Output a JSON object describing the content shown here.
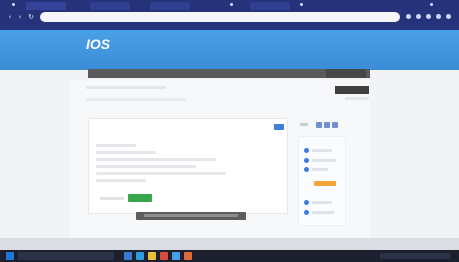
{
  "browser": {
    "tabs": [
      {
        "label": ""
      },
      {
        "label": ""
      },
      {
        "label": ""
      },
      {
        "label": ""
      }
    ],
    "address": "",
    "colors": {
      "chrome": "#26337a",
      "address_bar": "#f5f6fa"
    }
  },
  "site": {
    "logo": "IOS",
    "logo_sub": "",
    "tagline": "",
    "header_right": "",
    "colors": {
      "header": "#3a8cd6",
      "menu": "#5a5a5a"
    }
  },
  "menu": {
    "items": [
      {
        "label": ""
      },
      {
        "label": ""
      },
      {
        "label": ""
      },
      {
        "label": ""
      }
    ]
  },
  "page": {
    "submit_label": ""
  },
  "question": {
    "text": "",
    "options": [
      "",
      "",
      "",
      "",
      "",
      ""
    ],
    "next_label": "",
    "colors": {
      "next": "#3aa64a",
      "badge": "#3f7fd8"
    }
  },
  "action_bar": {
    "label": ""
  },
  "side_panel": {
    "colors": {
      "radio": "#3e7be0",
      "highlight": "#f3a53a"
    }
  },
  "taskbar": {
    "icons": [
      "start-icon",
      "search-icon",
      "app-icon",
      "app-icon",
      "app-icon",
      "app-icon",
      "app-icon",
      "app-icon"
    ],
    "colors": {
      "bar": "#1b1f2e",
      "start": "#1e76d8"
    }
  }
}
